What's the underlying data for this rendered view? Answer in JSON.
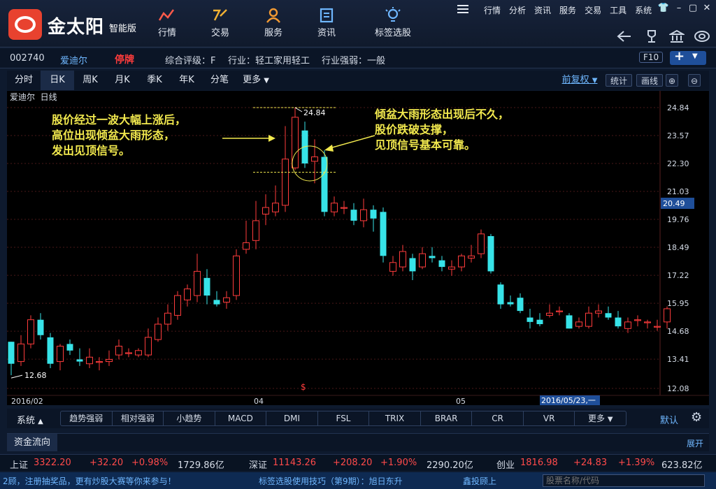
{
  "app": {
    "logo_text": "金太阳",
    "logo_sub": "智能版"
  },
  "nav": [
    {
      "label": "行情",
      "icon": "chart-line-icon"
    },
    {
      "label": "交易",
      "icon": "trade-icon"
    },
    {
      "label": "服务",
      "icon": "user-icon"
    },
    {
      "label": "资讯",
      "icon": "news-icon"
    },
    {
      "label": "标签选股",
      "icon": "lightbulb-icon"
    }
  ],
  "topmenu": [
    "行情",
    "分析",
    "资讯",
    "服务",
    "交易",
    "工具",
    "系统"
  ],
  "stock": {
    "code": "002740",
    "name": "爱迪尔",
    "status": "停牌",
    "rating": "综合评级：F",
    "industry": "行业：轻工家用轻工",
    "strength": "行业强弱：一般",
    "f10": "F10"
  },
  "periods": [
    "分时",
    "日K",
    "周K",
    "月K",
    "季K",
    "年K",
    "分笔",
    "更多"
  ],
  "active_period": "日K",
  "right_buttons": {
    "fq": "前复权",
    "stat": "统计",
    "draw": "画线"
  },
  "chart_labels": {
    "stock": "爱迪尔",
    "period": "日线",
    "date_start": "2016/02",
    "date_04": "04",
    "date_05": "05",
    "cursor_date": "2016/05/23,一",
    "dollar": "$"
  },
  "annotations": {
    "left": "股价经过一波大幅上涨后，\n高位出现倾盆大雨形态，\n发出见顶信号。",
    "right": "倾盆大雨形态出现后不久，\n股价跌破支撑，\n见顶信号基本可靠。"
  },
  "chart_data": {
    "type": "candlestick",
    "y_ticks": [
      24.84,
      23.57,
      22.3,
      21.03,
      19.76,
      18.49,
      17.22,
      15.95,
      14.68,
      13.41,
      12.08
    ],
    "ylim": [
      12.08,
      24.84
    ],
    "current_price": 20.49,
    "high_label": "24.84",
    "low_label": "12.68",
    "colors": {
      "up": "#ff3c3c",
      "down": "#37e3e8"
    },
    "candles": [
      [
        14.2,
        13.2,
        14.2,
        12.68
      ],
      [
        13.3,
        14.1,
        14.5,
        13.1
      ],
      [
        14.1,
        15.2,
        15.4,
        13.9
      ],
      [
        15.2,
        14.5,
        15.5,
        14.3
      ],
      [
        14.4,
        13.2,
        14.6,
        13.0
      ],
      [
        13.3,
        14.0,
        14.1,
        12.9
      ],
      [
        14.1,
        13.8,
        14.3,
        13.6
      ],
      [
        13.4,
        13.3,
        13.9,
        13.1
      ],
      [
        13.2,
        13.5,
        13.9,
        13.0
      ],
      [
        13.3,
        13.3,
        13.5,
        12.9
      ],
      [
        13.3,
        13.4,
        13.8,
        13.1
      ],
      [
        13.6,
        14.0,
        14.3,
        13.4
      ],
      [
        13.7,
        13.7,
        13.9,
        13.5
      ],
      [
        13.6,
        13.8,
        13.9,
        13.5
      ],
      [
        13.6,
        14.4,
        14.8,
        13.5
      ],
      [
        14.3,
        15.0,
        15.3,
        14.2
      ],
      [
        15.0,
        15.5,
        15.9,
        14.7
      ],
      [
        15.4,
        16.3,
        16.5,
        15.2
      ],
      [
        16.1,
        16.6,
        16.8,
        15.8
      ],
      [
        16.3,
        17.4,
        18.2,
        16.0
      ],
      [
        17.1,
        16.3,
        17.5,
        15.9
      ],
      [
        16.1,
        15.9,
        16.5,
        15.8
      ],
      [
        16.0,
        16.2,
        16.5,
        15.7
      ],
      [
        16.3,
        18.1,
        18.4,
        16.1
      ],
      [
        18.4,
        18.7,
        19.7,
        18.2
      ],
      [
        18.8,
        19.7,
        20.6,
        18.4
      ],
      [
        20.0,
        20.3,
        20.9,
        19.5
      ],
      [
        20.1,
        20.5,
        21.3,
        19.9
      ],
      [
        20.4,
        22.5,
        24.0,
        20.1
      ],
      [
        22.1,
        24.4,
        24.84,
        22.0
      ],
      [
        23.8,
        22.3,
        24.2,
        22.1
      ],
      [
        22.4,
        22.6,
        23.4,
        21.4
      ],
      [
        22.6,
        20.1,
        22.9,
        19.9
      ],
      [
        20.1,
        20.5,
        20.8,
        19.9
      ],
      [
        20.3,
        20.3,
        20.6,
        20.0
      ],
      [
        20.2,
        19.7,
        20.5,
        19.5
      ],
      [
        19.7,
        20.2,
        20.7,
        19.4
      ],
      [
        20.2,
        19.8,
        20.4,
        19.2
      ],
      [
        20.1,
        18.1,
        20.3,
        17.8
      ],
      [
        17.4,
        17.8,
        18.1,
        17.2
      ],
      [
        17.6,
        18.3,
        18.6,
        17.4
      ],
      [
        18.0,
        17.4,
        18.2,
        17.0
      ],
      [
        17.6,
        18.2,
        18.5,
        17.5
      ],
      [
        18.1,
        18.0,
        18.5,
        17.8
      ],
      [
        17.9,
        17.6,
        18.1,
        17.4
      ],
      [
        17.5,
        17.6,
        17.9,
        17.2
      ],
      [
        17.6,
        18.1,
        18.2,
        17.4
      ],
      [
        18.0,
        18.1,
        18.6,
        17.8
      ],
      [
        18.2,
        19.1,
        19.3,
        18.0
      ],
      [
        19.0,
        17.4,
        19.1,
        17.3
      ],
      [
        16.8,
        15.9,
        16.9,
        15.7
      ],
      [
        16.0,
        15.9,
        16.3,
        15.8
      ],
      [
        16.2,
        15.6,
        16.4,
        15.5
      ],
      [
        15.3,
        15.1,
        15.7,
        14.8
      ],
      [
        15.2,
        15.0,
        15.5,
        14.9
      ],
      [
        15.4,
        15.5,
        15.9,
        15.3
      ],
      [
        15.6,
        15.6,
        15.8,
        15.4
      ],
      [
        15.4,
        14.8,
        15.5,
        14.8
      ],
      [
        14.9,
        15.1,
        15.3,
        14.8
      ],
      [
        14.9,
        15.5,
        15.8,
        14.8
      ],
      [
        15.5,
        15.6,
        15.9,
        15.3
      ],
      [
        15.5,
        15.3,
        15.8,
        15.2
      ],
      [
        15.3,
        14.9,
        15.6,
        14.8
      ],
      [
        14.8,
        15.1,
        15.3,
        14.6
      ],
      [
        15.2,
        15.2,
        15.4,
        14.9
      ],
      [
        15.1,
        15.1,
        15.2,
        14.8
      ],
      [
        14.9,
        14.9,
        15.2,
        14.7
      ],
      [
        15.1,
        15.7,
        15.8,
        14.8
      ]
    ]
  },
  "indicators": {
    "system": "系统",
    "tabs": [
      "趋势强弱",
      "相对强弱",
      "小趋势",
      "MACD",
      "DMI",
      "FSL",
      "TRIX",
      "BRAR",
      "CR",
      "VR",
      "更多"
    ],
    "default": "默认"
  },
  "fundflow": {
    "title": "资金流向",
    "expand": "展开"
  },
  "indexes": [
    {
      "name": "上证",
      "price": "3322.20",
      "chg": "+32.20",
      "pct": "+0.98%",
      "amt": "1729.86亿"
    },
    {
      "name": "深证",
      "price": "11143.26",
      "chg": "+208.20",
      "pct": "+1.90%",
      "amt": "2290.20亿"
    },
    {
      "name": "创业",
      "price": "1816.98",
      "chg": "+24.83",
      "pct": "+1.39%",
      "amt": "623.82亿"
    }
  ],
  "status": {
    "promo": "2顾，注册抽奖品，更有炒股大赛等你来参与！",
    "tips": "标签选股使用技巧（第9期）：旭日东升",
    "broker": "鑫投顾上",
    "search_placeholder": "股票名称/代码"
  }
}
